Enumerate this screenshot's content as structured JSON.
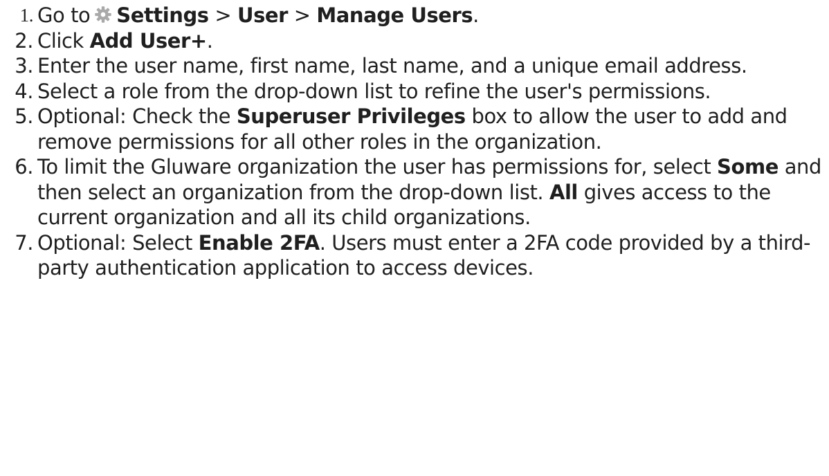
{
  "steps": [
    {
      "num": "1.",
      "parts": {
        "a": "Go to",
        "settings": "Settings",
        "sep1": " > ",
        "user": "User",
        "sep2": " > ",
        "manage": "Manage Users",
        "end": "."
      },
      "icon": "gear-icon"
    },
    {
      "num": "2.",
      "parts": {
        "a": "Click ",
        "add": "Add User+",
        "end": "."
      }
    },
    {
      "num": "3.",
      "text": "Enter the user name, first name, last name, and a unique email address."
    },
    {
      "num": "4.",
      "text": "Select a role from the drop-down list to refine the user's permissions."
    },
    {
      "num": "5.",
      "parts": {
        "a": "Optional: Check the ",
        "superuser": "Superuser Privileges",
        "b": " box to allow the user to add and remove permissions for all other roles in the organization."
      }
    },
    {
      "num": "6.",
      "parts": {
        "a": "To limit the Gluware organization the user has permissions for, select ",
        "some": "Some",
        "b": " and then select an organization from the drop-down list. ",
        "all": "All",
        "c": " gives access to the current organization and all its child organizations."
      }
    },
    {
      "num": "7.",
      "parts": {
        "a": "Optional: Select ",
        "enable": "Enable 2FA",
        "b": ". Users must enter a 2FA code provided by a third-party authentication application to access devices."
      }
    }
  ],
  "colors": {
    "text": "#1f1f1f",
    "gear": "#a9a9a9"
  }
}
